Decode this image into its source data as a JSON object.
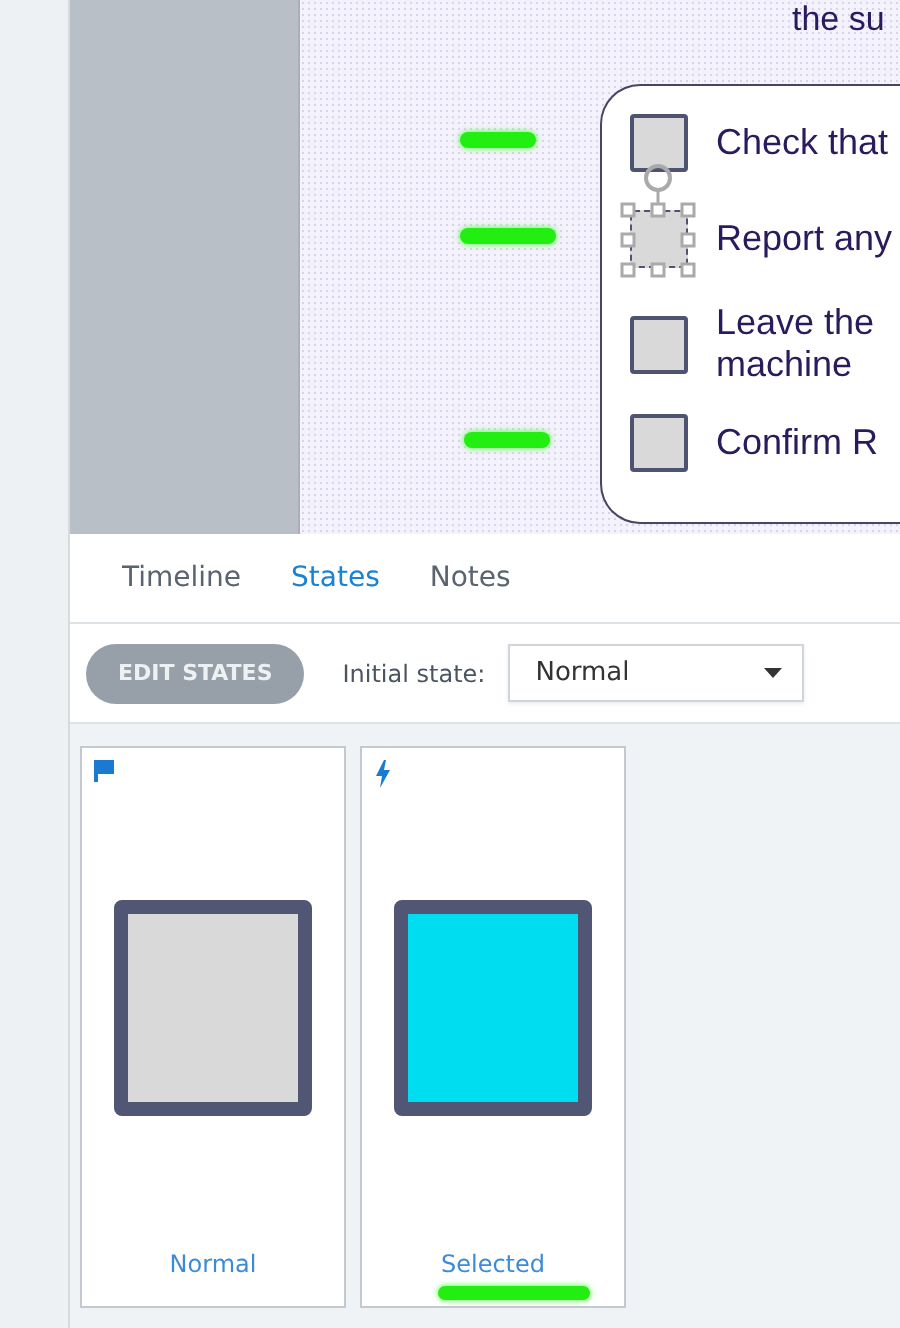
{
  "slide": {
    "heading_fragment": "the su",
    "checklist": [
      {
        "lines": [
          "Check that"
        ],
        "selected": false,
        "marked": true
      },
      {
        "lines": [
          "Report any"
        ],
        "selected": true,
        "marked": true
      },
      {
        "lines": [
          "Leave the",
          "machine"
        ],
        "selected": false,
        "marked": false
      },
      {
        "lines": [
          "Confirm R"
        ],
        "selected": false,
        "marked": true
      }
    ]
  },
  "tabs": [
    {
      "label": "Timeline",
      "selected": false
    },
    {
      "label": "States",
      "selected": true
    },
    {
      "label": "Notes",
      "selected": false
    }
  ],
  "toolbar": {
    "button": "EDIT STATES",
    "initial_state_label": "Initial state:",
    "initial_state_value": "Normal"
  },
  "states": [
    {
      "kind": "initial",
      "label": "Normal",
      "color": "#d9d9d9",
      "marked": false
    },
    {
      "kind": "trigger",
      "label": "Selected",
      "color": "#00dcf0",
      "marked": true
    }
  ]
}
